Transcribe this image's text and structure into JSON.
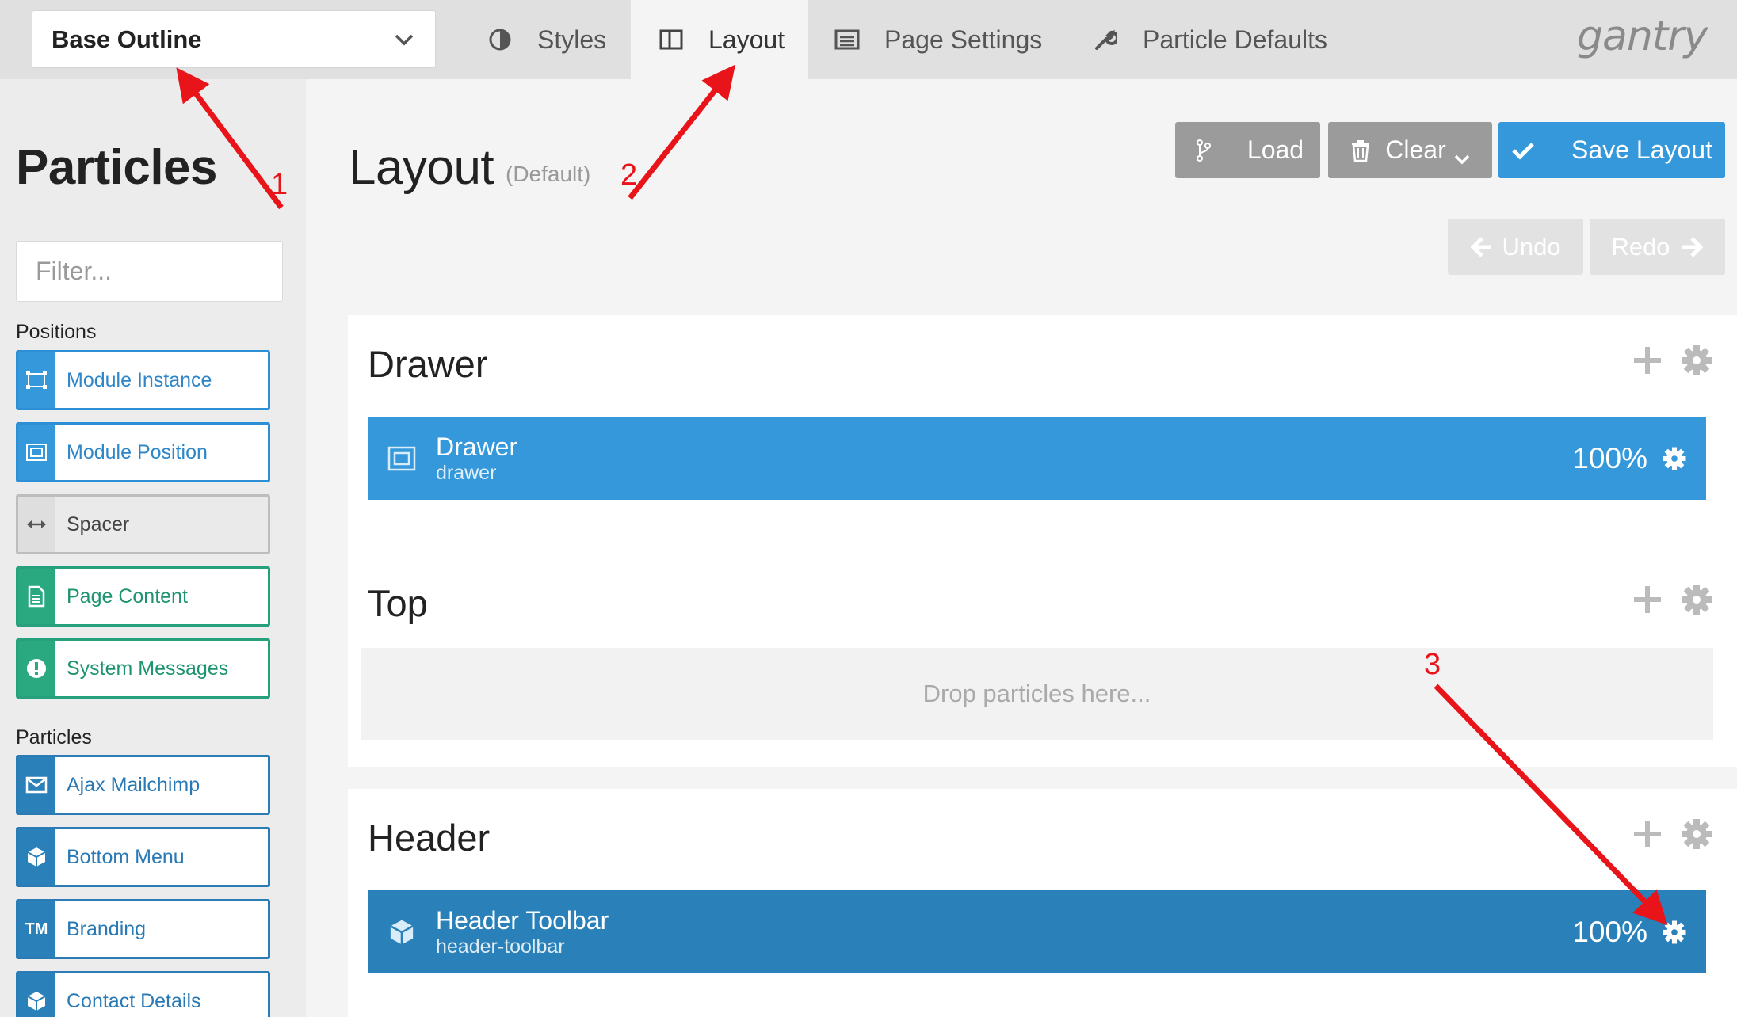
{
  "topbar": {
    "outline_select": "Base Outline",
    "tabs": [
      {
        "label": "Styles",
        "icon": "half-circle-icon"
      },
      {
        "label": "Layout",
        "icon": "columns-icon",
        "active": true
      },
      {
        "label": "Page Settings",
        "icon": "list-window-icon"
      },
      {
        "label": "Particle Defaults",
        "icon": "wrench-icon"
      }
    ],
    "brand": "gantry"
  },
  "sidebar": {
    "title": "Particles",
    "filter_placeholder": "Filter...",
    "groups": [
      {
        "label": "Positions",
        "items": [
          {
            "label": "Module Instance",
            "icon": "module-instance-icon",
            "color": "#3498db"
          },
          {
            "label": "Module Position",
            "icon": "module-position-icon",
            "color": "#3498db"
          },
          {
            "label": "Spacer",
            "icon": "arrows-horizontal-icon",
            "color": "#bdbdbd"
          },
          {
            "label": "Page Content",
            "icon": "document-icon",
            "color": "#2aa980"
          },
          {
            "label": "System Messages",
            "icon": "exclamation-icon",
            "color": "#2aa980"
          }
        ]
      },
      {
        "label": "Particles",
        "items": [
          {
            "label": "Ajax Mailchimp",
            "icon": "envelope-icon",
            "color": "#2a80b9"
          },
          {
            "label": "Bottom Menu",
            "icon": "cube-icon",
            "color": "#2a80b9"
          },
          {
            "label": "Branding",
            "icon": "tm-icon",
            "icon_text": "TM",
            "color": "#2a80b9"
          },
          {
            "label": "Contact Details",
            "icon": "cube-icon",
            "color": "#2a80b9"
          }
        ]
      }
    ]
  },
  "main": {
    "title": "Layout",
    "subtitle": "(Default)",
    "buttons": {
      "load": "Load",
      "clear": "Clear",
      "save": "Save Layout",
      "undo": "Undo",
      "redo": "Redo"
    },
    "sections": [
      {
        "title": "Drawer",
        "particles": [
          {
            "name": "Drawer",
            "id": "drawer",
            "width": "100%"
          }
        ]
      },
      {
        "title": "Top",
        "dropzone": "Drop particles here..."
      },
      {
        "title": "Header",
        "particles": [
          {
            "name": "Header Toolbar",
            "id": "header-toolbar",
            "width": "100%"
          }
        ]
      }
    ]
  },
  "annotations": {
    "numbers": [
      "1",
      "2",
      "3"
    ],
    "color": "#e8141a"
  }
}
